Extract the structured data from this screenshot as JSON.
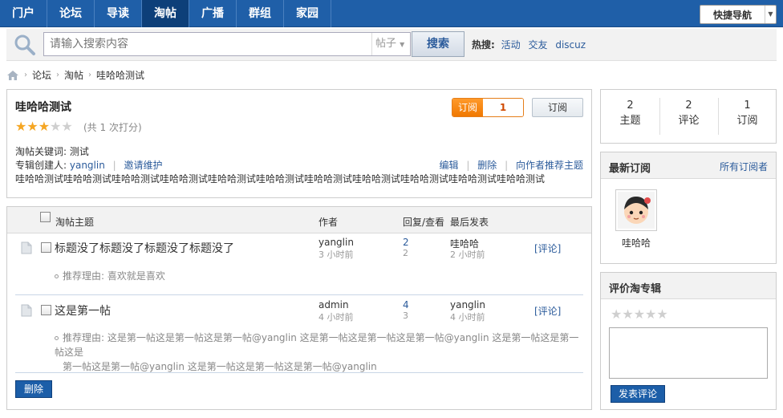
{
  "nav": {
    "items": [
      {
        "label": "门户",
        "active": false
      },
      {
        "label": "论坛",
        "active": false
      },
      {
        "label": "导读",
        "active": false
      },
      {
        "label": "淘帖",
        "active": true
      },
      {
        "label": "广播",
        "active": false
      },
      {
        "label": "群组",
        "active": false
      },
      {
        "label": "家园",
        "active": false
      }
    ],
    "quick_nav_label": "快捷导航"
  },
  "search": {
    "placeholder": "请输入搜索内容",
    "type_label": "帖子",
    "button_label": "搜索",
    "hot_label": "热搜:",
    "hot_terms": [
      "活动",
      "交友",
      "discuz"
    ]
  },
  "breadcrumb": [
    "论坛",
    "淘帖",
    "哇哈哈测试"
  ],
  "album": {
    "title": "哇哈哈测试",
    "rating": 3,
    "rating_max": 5,
    "rating_text": "(共 1 次打分)",
    "keywords_label": "淘帖关键词:",
    "keywords": "测试",
    "creator_label": "专辑创建人:",
    "creator": "yanglin",
    "invite_label": "邀请维护",
    "actions": [
      "编辑",
      "删除",
      "向作者推荐主题"
    ],
    "description": "哇哈哈测试哇哈哈测试哇哈哈测试哇哈哈测试哇哈哈测试哇哈哈测试哇哈哈测试哇哈哈测试哇哈哈测试哇哈哈测试哇哈哈测试",
    "subscribe_label": "订阅",
    "subscribe_count": "1",
    "subscribe_button": "订阅"
  },
  "thread_list": {
    "headers": {
      "subject": "淘帖主题",
      "author": "作者",
      "reply_view": "回复/查看",
      "last_post": "最后发表"
    },
    "rows": [
      {
        "title": "标题没了标题没了标题没了标题没了",
        "author": "yanglin",
        "author_time": "3 小时前",
        "replies": "2",
        "views": "2",
        "last_user": "哇哈哈",
        "last_time": "2 小时前",
        "comment_label": "[评论]",
        "reason_lines": [
          "推荐理由: 喜欢就是喜欢"
        ]
      },
      {
        "title": "这是第一帖",
        "author": "admin",
        "author_time": "4 小时前",
        "replies": "4",
        "views": "3",
        "last_user": "yanglin",
        "last_time": "4 小时前",
        "comment_label": "[评论]",
        "reason_lines": [
          "推荐理由: 这是第一帖这是第一帖这是第一帖@yanglin 这是第一帖这是第一帖这是第一帖@yanglin 这是第一帖这是第一帖这是",
          "第一帖这是第一帖@yanglin 这是第一帖这是第一帖这是第一帖@yanglin"
        ]
      }
    ],
    "delete_label": "删除"
  },
  "stats": [
    {
      "value": "2",
      "label": "主题"
    },
    {
      "value": "2",
      "label": "评论"
    },
    {
      "value": "1",
      "label": "订阅"
    }
  ],
  "latest_subscribers": {
    "title": "最新订阅",
    "all_link": "所有订阅者",
    "users": [
      {
        "name": "哇哈哈"
      }
    ]
  },
  "review": {
    "title": "评价淘专辑",
    "rating": 0,
    "rating_max": 5,
    "submit_label": "发表评论"
  },
  "colors": {
    "nav_bg": "#1f5fa8",
    "nav_active": "#0d3f79",
    "link": "#2b5b9b",
    "subscribe_orange": "#f07800",
    "star_on": "#f5a623",
    "star_off": "#cfcfcf",
    "button_blue": "#1c5ea8"
  }
}
